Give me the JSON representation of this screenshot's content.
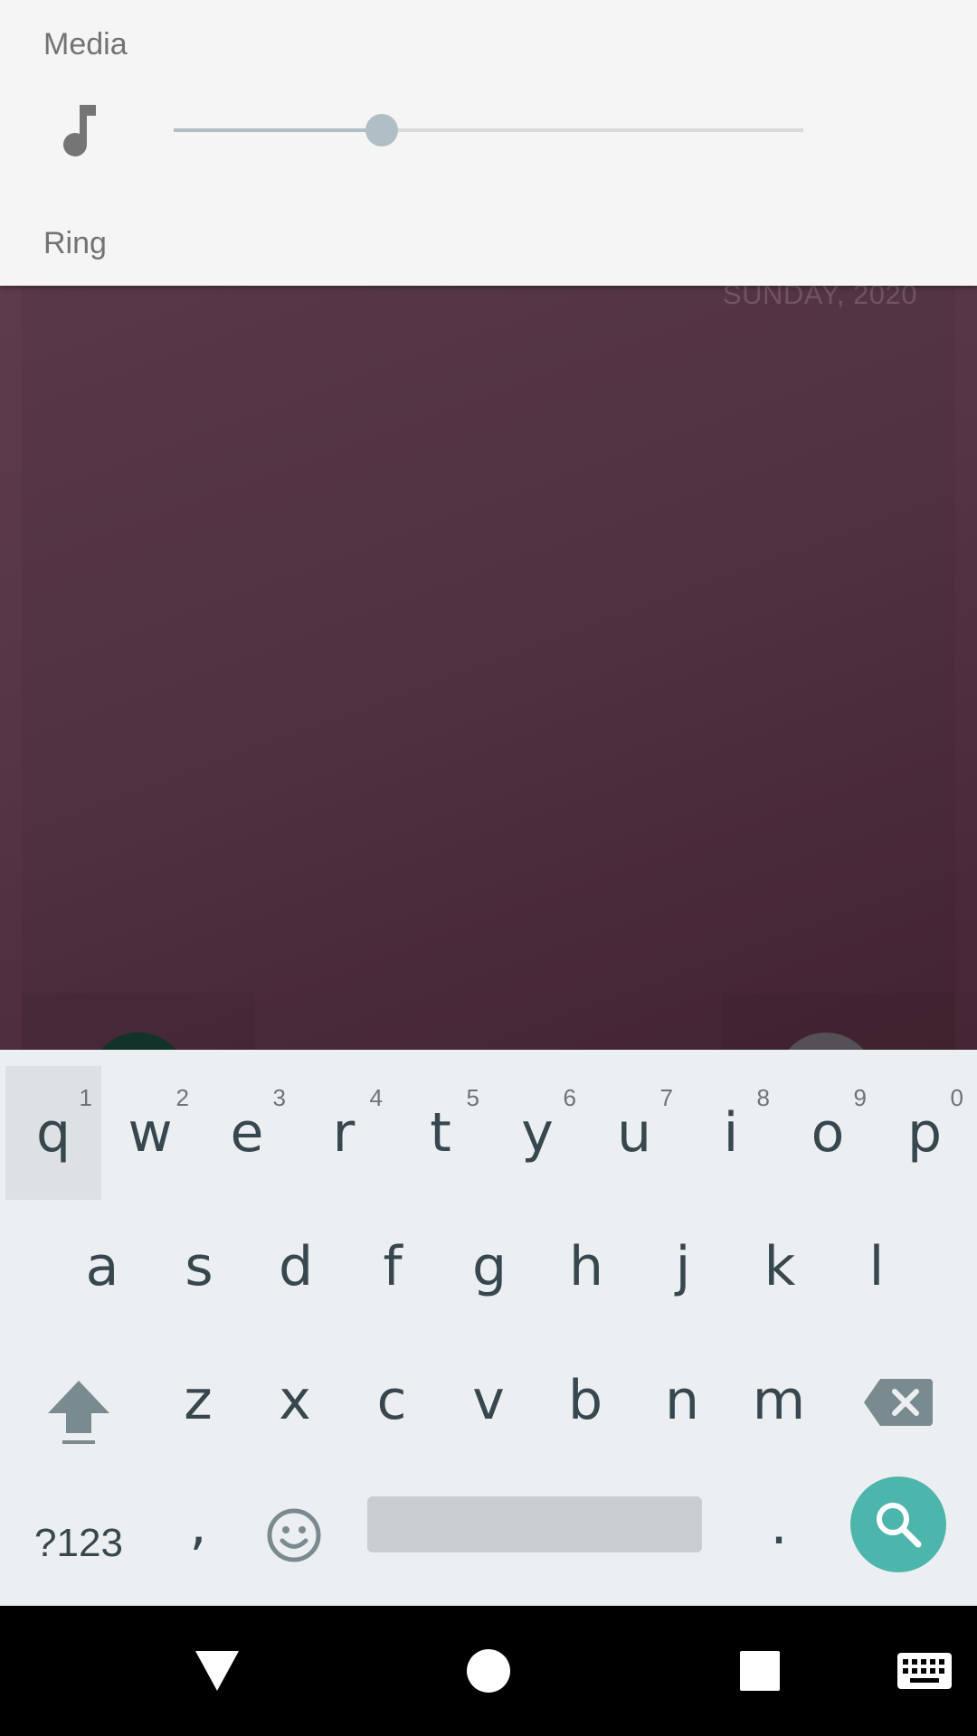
{
  "volume_panel": {
    "media_label": "Media",
    "ring_label": "Ring",
    "media_level": 0.33,
    "icon": "music-note-icon"
  },
  "background": {
    "date_text": "SUNDAY, 2020"
  },
  "keyboard": {
    "row1": [
      {
        "key": "q",
        "hint": "1"
      },
      {
        "key": "w",
        "hint": "2"
      },
      {
        "key": "e",
        "hint": "3"
      },
      {
        "key": "r",
        "hint": "4"
      },
      {
        "key": "t",
        "hint": "5"
      },
      {
        "key": "y",
        "hint": "6"
      },
      {
        "key": "u",
        "hint": "7"
      },
      {
        "key": "i",
        "hint": "8"
      },
      {
        "key": "o",
        "hint": "9"
      },
      {
        "key": "p",
        "hint": "0"
      }
    ],
    "row2": [
      "a",
      "s",
      "d",
      "f",
      "g",
      "h",
      "j",
      "k",
      "l"
    ],
    "row3": [
      "z",
      "x",
      "c",
      "v",
      "b",
      "n",
      "m"
    ],
    "symbols_label": "?123",
    "comma": ",",
    "period": ".",
    "pressed_key": "q",
    "accent_color": "#4db6ac"
  },
  "navbar": {
    "icons": [
      "back-icon",
      "home-icon",
      "recents-icon",
      "keyboard-switch-icon"
    ]
  }
}
